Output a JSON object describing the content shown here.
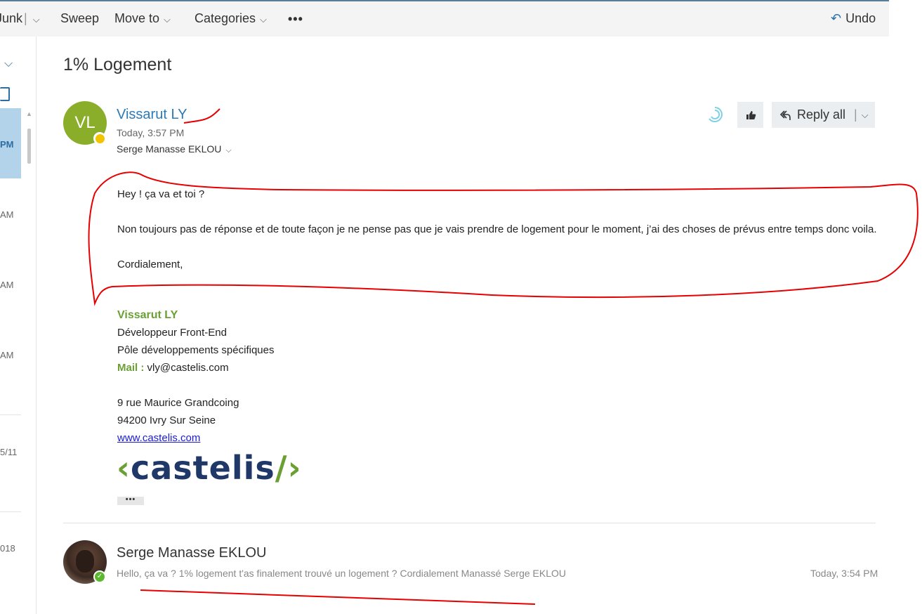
{
  "toolbar": {
    "junk_label": "Junk",
    "sweep_label": "Sweep",
    "move_to_label": "Move to",
    "categories_label": "Categories",
    "more_label": "•••",
    "undo_label": "Undo"
  },
  "message_list": {
    "times": [
      "PM",
      "AM",
      "AM",
      "AM",
      "5/11",
      "018"
    ]
  },
  "subject": "1% Logement",
  "message": {
    "avatar_initials": "VL",
    "avatar_color": "#8aad2a",
    "sender": "Vissarut LY",
    "timestamp": "Today, 3:57 PM",
    "recipient": "Serge Manasse EKLOU",
    "reply_all_label": "Reply all",
    "body": {
      "greeting": "Hey ! ça va et toi ?",
      "paragraph": "Non toujours pas de réponse et de toute façon je ne pense pas que je vais prendre de logement pour le moment, j’ai des choses de prévus entre temps donc voila.",
      "closing": "Cordialement,"
    },
    "signature": {
      "name": "Vissarut LY",
      "title": "Développeur Front-End",
      "department": "Pôle développements spécifiques",
      "mail_label": "Mail :",
      "mail": "vly@castelis.com",
      "address_line1": "9 rue Maurice Grandcoing",
      "address_line2": "94200 Ivry Sur Seine",
      "website": "www.castelis.com",
      "logo_text": "castelis",
      "logo_left": "‹",
      "logo_right": "/›"
    },
    "more_label": "•••"
  },
  "previous_message": {
    "sender": "Serge Manasse EKLOU",
    "preview": "Hello, ça va ? 1% logement t'as finalement trouvé un logement ? Cordialement Manassé Serge EKLOU",
    "timestamp": "Today, 3:54 PM"
  },
  "colors": {
    "accent": "#2b7ab8",
    "signature_green": "#6aa033",
    "annotation_red": "#e60000"
  }
}
